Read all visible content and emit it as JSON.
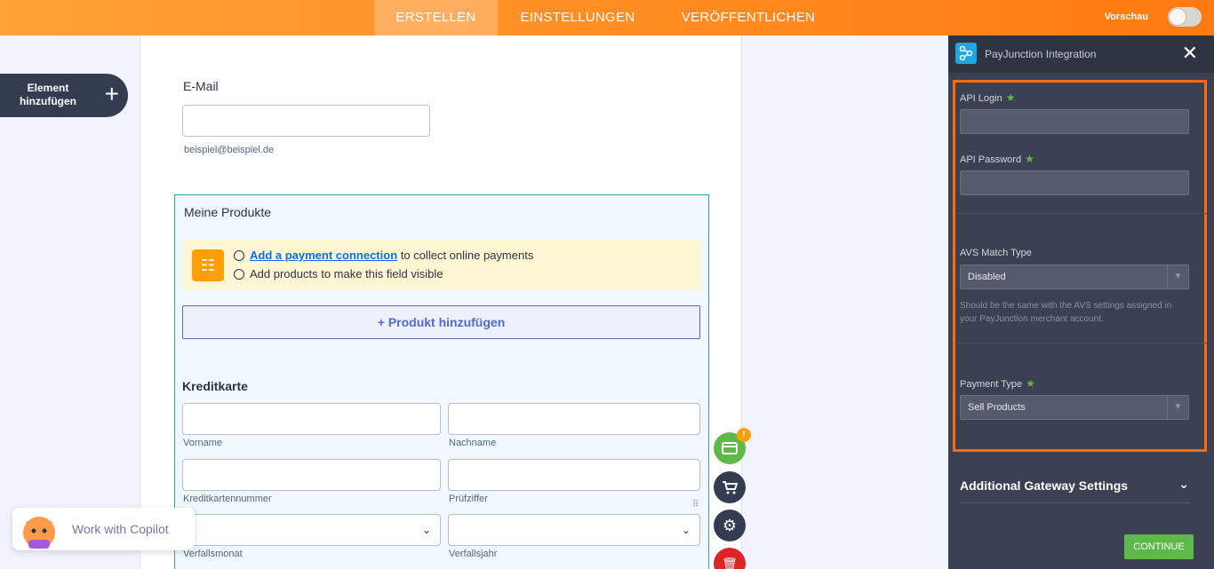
{
  "topbar": {
    "tabs": [
      {
        "label": "ERSTELLEN",
        "active": true
      },
      {
        "label": "EINSTELLUNGEN",
        "active": false
      },
      {
        "label": "VERÖFFENTLICHEN",
        "active": false
      }
    ],
    "preview_label": "Vorschau"
  },
  "sidebar": {
    "add_element_label": "Element hinzufügen",
    "add_icon": "+"
  },
  "form": {
    "email_label": "E-Mail",
    "email_value": "",
    "email_sublabel": "beispiel@beispiel.de",
    "products_title": "Meine Produkte",
    "notice_link": "Add a payment connection",
    "notice_line1_rest": " to collect online payments",
    "notice_line2": "Add products to make this field visible",
    "add_product_label": "+ Produkt hinzufügen",
    "cc_title": "Kreditkarte",
    "cc_fields": {
      "first_name": "Vorname",
      "last_name": "Nachname",
      "card_number": "Kreditkartennummer",
      "cvv": "Prüfziffer",
      "exp_month": "Verfallsmonat",
      "exp_year": "Verfallsjahr"
    }
  },
  "fab": {
    "badge": "!",
    "icons": [
      "credit-card-icon",
      "cart-icon",
      "gear-icon",
      "trash-icon"
    ]
  },
  "copilot": {
    "label": "Work with Copilot"
  },
  "panel": {
    "title": "PayJunction Integration",
    "api_login_label": "API Login",
    "api_password_label": "API Password",
    "avs_label": "AVS Match Type",
    "avs_value": "Disabled",
    "avs_help": "Should be the same with the AVS settings assigned in your PayJunction merchant account.",
    "payment_type_label": "Payment Type",
    "payment_type_value": "Sell Products",
    "additional_settings": "Additional Gateway Settings",
    "continue_label": "CONTINUE"
  },
  "colors": {
    "accent_orange": "#ff7a10",
    "panel_bg": "#3b4152",
    "continue_green": "#5fb94a",
    "highlight": "#ff6b0a"
  }
}
